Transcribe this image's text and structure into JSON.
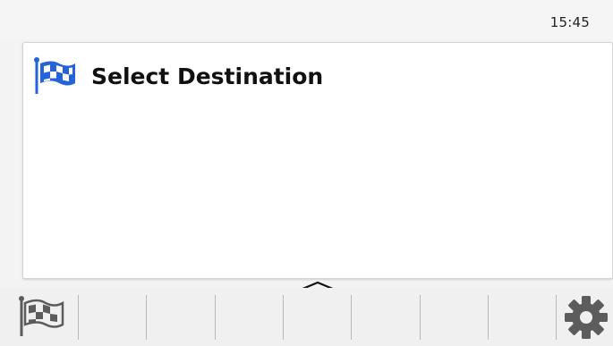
{
  "status_bar": {
    "time": "15:45"
  },
  "card": {
    "title": "Select Destination",
    "icon": "checkered-flag-icon",
    "icon_color": "#2563d9"
  },
  "bottom_bar": {
    "expand_icon": "chevron-up-icon",
    "left_icon": "checkered-flag-icon",
    "right_icon": "gear-icon",
    "icon_color": "#5c5c5c"
  }
}
